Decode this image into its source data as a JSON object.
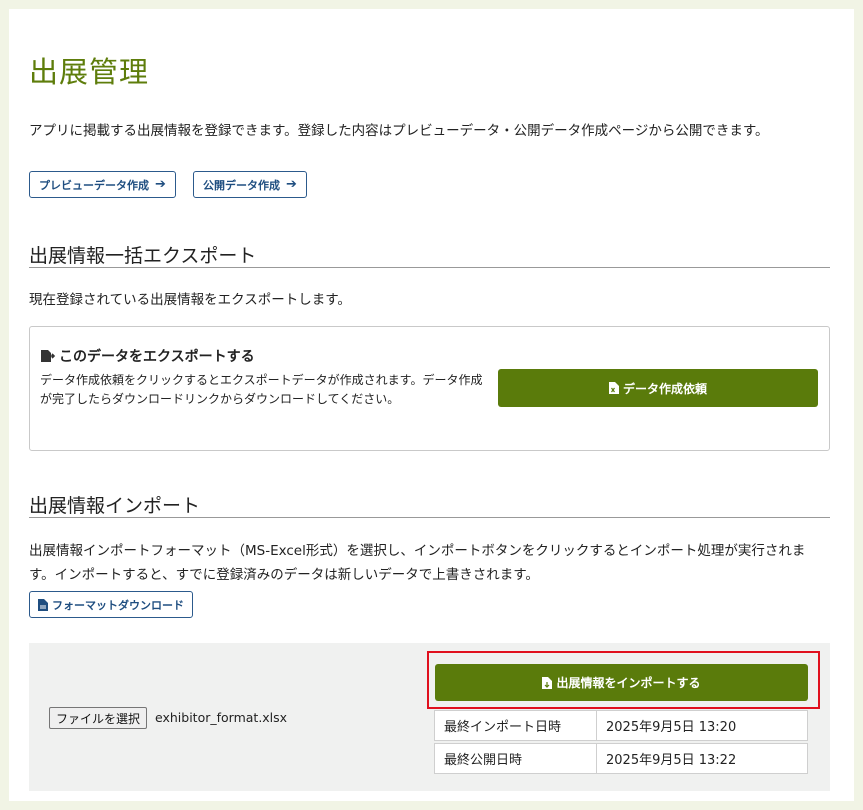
{
  "page": {
    "title": "出展管理",
    "intro": "アプリに掲載する出展情報を登録できます。登録した内容はプレビューデータ・公開データ作成ページから公開できます。",
    "buttons": {
      "preview": "プレビューデータ作成",
      "public": "公開データ作成"
    }
  },
  "export": {
    "section_title": "出展情報一括エクスポート",
    "description": "現在登録されている出展情報をエクスポートします。",
    "box_heading": "このデータをエクスポートする",
    "box_text": "データ作成依頼をクリックするとエクスポートデータが作成されます。データ作成が完了したらダウンロードリンクからダウンロードしてください。",
    "request_button": "データ作成依頼"
  },
  "import": {
    "section_title": "出展情報インポート",
    "description": "出展情報インポートフォーマット（MS-Excel形式）を選択し、インポートボタンをクリックするとインポート処理が実行されます。インポートすると、すでに登録済みのデータは新しいデータで上書きされます。",
    "format_button": "フォーマットダウンロード",
    "file_button": "ファイルを選択",
    "file_name": "exhibitor_format.xlsx",
    "import_button": "出展情報をインポートする",
    "info": [
      {
        "label": "最終インポート日時",
        "value": "2025年9月5日 13:20"
      },
      {
        "label": "最終公開日時",
        "value": "2025年9月5日 13:22"
      }
    ]
  },
  "colors": {
    "accent_green": "#5a7b0b",
    "title_green": "#5e7d0b",
    "link_blue": "#1f4e80",
    "highlight_red": "#e0101e",
    "background": "#f1f4e5"
  },
  "icons": [
    "arrow-right-icon",
    "file-export-icon",
    "excel-file-icon",
    "file-icon"
  ]
}
